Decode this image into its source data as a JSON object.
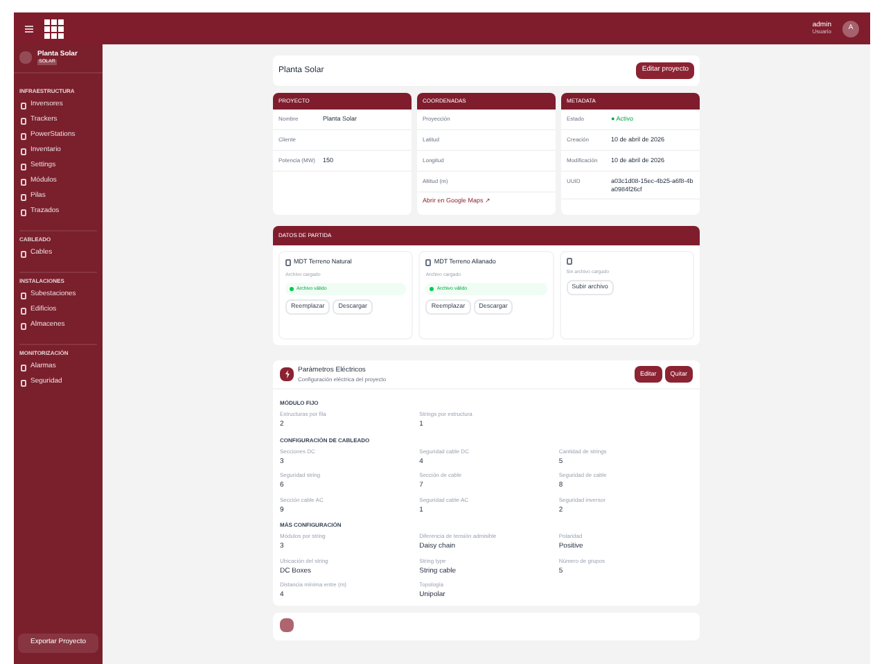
{
  "topbar": {
    "user_name": "admin",
    "user_role": "Usuario",
    "avatar": "A"
  },
  "sidebar": {
    "project": {
      "title": "Planta Solar",
      "badge": "SOLAR"
    },
    "sections": [
      {
        "title": "INFRAESTRUCTURA",
        "items": [
          {
            "label": "Inversores",
            "selected": false
          },
          {
            "label": "Trackers",
            "selected": false
          },
          {
            "label": "PowerStations",
            "selected": false
          },
          {
            "label": "Inventario",
            "selected": false
          },
          {
            "label": "Settings",
            "selected": false
          },
          {
            "label": "Módulos",
            "selected": false
          },
          {
            "label": "Pilas",
            "selected": false
          },
          {
            "label": "Trazados",
            "selected": false
          }
        ]
      },
      {
        "title": "CABLEADO",
        "items": [
          {
            "label": "Cables",
            "selected": false
          }
        ]
      },
      {
        "title": "INSTALACIONES",
        "items": [
          {
            "label": "Subestaciones",
            "selected": false
          },
          {
            "label": "Edificios",
            "selected": false
          },
          {
            "label": "Almacenes",
            "selected": false
          }
        ]
      },
      {
        "title": "MONITORIZACIÓN",
        "items": [
          {
            "label": "Alarmas",
            "selected": false
          },
          {
            "label": "Seguridad",
            "selected": false
          }
        ]
      }
    ],
    "export_button": "Exportar Proyecto"
  },
  "header": {
    "title": "Planta Solar",
    "edit_button": "Editar proyecto"
  },
  "info_cards": [
    {
      "title": "PROYECTO",
      "rows": [
        {
          "label": "Nombre",
          "value": "Planta Solar"
        },
        {
          "label": "Cliente"
        },
        {
          "label": "Potencia (MW)",
          "value": "150"
        }
      ]
    },
    {
      "title": "COORDENADAS",
      "rows": [
        {
          "label": "Proyección"
        },
        {
          "label": "Latitud"
        },
        {
          "label": "Longitud"
        },
        {
          "label": "Altitud (m)"
        }
      ],
      "link": "Abrir en Google Maps ↗"
    },
    {
      "title": "METADATA",
      "rows": [
        {
          "label": "Estado",
          "value": "● Activo",
          "kind": "status"
        },
        {
          "label": "Creación",
          "value": "10 de abril de 2026"
        },
        {
          "label": "Modificación",
          "value": "10 de abril de 2026"
        },
        {
          "label": "UUID",
          "value": "a03c1d08-15ec-4b25-a6f8-4ba0984f26cf"
        }
      ]
    }
  ],
  "inputs": {
    "title": "DATOS DE PARTIDA",
    "files": [
      {
        "title": "MDT Terreno Natural",
        "subtitle": "Archivo cargado",
        "loaded": true,
        "status": "Archivo válido",
        "buttons": [
          "Reemplazar",
          "Descargar"
        ]
      },
      {
        "title": "MDT Terreno Allanado",
        "subtitle": "Archivo cargado",
        "loaded": true,
        "status": "Archivo válido",
        "buttons": [
          "Reemplazar",
          "Descargar"
        ]
      },
      {
        "subtitle": "Sin archivo cargado",
        "loaded": false,
        "buttons": [
          "Subir archivo"
        ]
      }
    ]
  },
  "electrical": {
    "title": "Parámetros Eléctricos",
    "subtitle": "Configuración eléctrica del proyecto",
    "buttons": [
      "Editar",
      "Quitar"
    ],
    "groups": [
      {
        "title": "MÓDULO FIJO",
        "fields": [
          {
            "label": "Estructuras por fila",
            "value": "2"
          },
          {
            "label": "Strings por estructura",
            "value": "1"
          }
        ]
      },
      {
        "title": "CONFIGURACIÓN DE CABLEADO",
        "fields": [
          {
            "label": "Secciones DC",
            "value": "3"
          },
          {
            "label": "Seguridad cable DC",
            "value": "4"
          },
          {
            "label": "Cantidad de strings",
            "value": "5"
          },
          {
            "label": "Seguridad string",
            "value": "6"
          },
          {
            "label": "Sección de cable",
            "value": "7"
          },
          {
            "label": "Seguridad de cable",
            "value": "8"
          },
          {
            "label": "Sección cable AC",
            "value": "9"
          },
          {
            "label": "Seguridad cable AC",
            "value": "1"
          },
          {
            "label": "Seguridad inversor",
            "value": "2"
          }
        ]
      },
      {
        "title": "MÁS CONFIGURACIÓN",
        "fields": [
          {
            "label": "Módulos por string",
            "value": "3"
          },
          {
            "label": "Diferencia de tensión admisible",
            "value": "Daisy chain"
          },
          {
            "label": "Polaridad",
            "value": "Positive"
          },
          {
            "label": "Ubicación del string",
            "value": "DC Boxes"
          },
          {
            "label": "String type",
            "value": "String cable"
          },
          {
            "label": "Número de grupos",
            "value": "5"
          },
          {
            "label": "Distancia mínima entre (m)",
            "value": "4"
          },
          {
            "label": "Topología",
            "value": "Unipolar"
          }
        ]
      }
    ]
  }
}
